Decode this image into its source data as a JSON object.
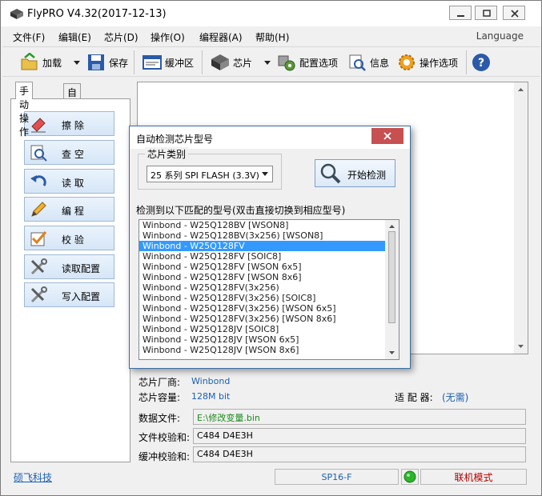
{
  "window": {
    "title": "FlyPRO V4.32(2017-12-13)"
  },
  "menu": {
    "items": [
      "文件(F)",
      "编辑(E)",
      "芯片(D)",
      "操作(O)",
      "编程器(A)",
      "帮助(H)"
    ],
    "language": "Language"
  },
  "toolbar": {
    "load": "加载",
    "save": "保存",
    "buffer": "缓冲区",
    "chip": "芯片",
    "config": "配置选项",
    "info": "信息",
    "options": "操作选项"
  },
  "left": {
    "tabs": [
      "手动操作",
      "自动编程"
    ],
    "buttons": [
      {
        "label": "擦    除",
        "icon": "eraser-icon"
      },
      {
        "label": "查    空",
        "icon": "blank-check-icon"
      },
      {
        "label": "读    取",
        "icon": "read-icon"
      },
      {
        "label": "编    程",
        "icon": "program-pencil-icon"
      },
      {
        "label": "校    验",
        "icon": "verify-icon"
      },
      {
        "label": "读取配置",
        "icon": "read-config-tools-icon"
      },
      {
        "label": "写入配置",
        "icon": "write-config-tools-icon"
      }
    ]
  },
  "info": {
    "maker_label": "芯片厂商:",
    "maker_value": "Winbond",
    "capacity_label": "芯片容量:",
    "capacity_value": "128M bit",
    "adapter_label": "适 配 器:",
    "adapter_value": "(无需)",
    "datafile_label": "数据文件:",
    "datafile_value": "E:\\修改变量.bin",
    "filechecksum_label": "文件校验和:",
    "filechecksum_value": "C484 D4E3H",
    "bufchecksum_label": "缓冲校验和:",
    "bufchecksum_value": "C484 D4E3H"
  },
  "status": {
    "company": "硕飞科技",
    "device": "SP16-F",
    "mode": "联机模式"
  },
  "dialog": {
    "title": "自动检测芯片型号",
    "group_label": "芯片类别",
    "category_value": "25 系列 SPI FLASH (3.3V)",
    "detect_button": "开始检测",
    "list_label": "检测到以下匹配的型号(双击直接切换到相应型号)",
    "selected_index": 2,
    "models": [
      "Winbond - W25Q128BV [WSON8]",
      "Winbond - W25Q128BV(3x256) [WSON8]",
      "Winbond - W25Q128FV",
      "Winbond - W25Q128FV [SOIC8]",
      "Winbond - W25Q128FV [WSON 6x5]",
      "Winbond - W25Q128FV [WSON 8x6]",
      "Winbond - W25Q128FV(3x256)",
      "Winbond - W25Q128FV(3x256) [SOIC8]",
      "Winbond - W25Q128FV(3x256) [WSON 6x5]",
      "Winbond - W25Q128FV(3x256) [WSON 8x6]",
      "Winbond - W25Q128JV [SOIC8]",
      "Winbond - W25Q128JV [WSON 6x5]",
      "Winbond - W25Q128JV [WSON 8x6]"
    ]
  },
  "colors": {
    "accent_blue": "#1a5fb4",
    "selection": "#3399ff",
    "close_red": "#c75050",
    "status_green": "#2bb52b",
    "path_green": "#1a8a1a",
    "mode_red": "#b00000"
  }
}
